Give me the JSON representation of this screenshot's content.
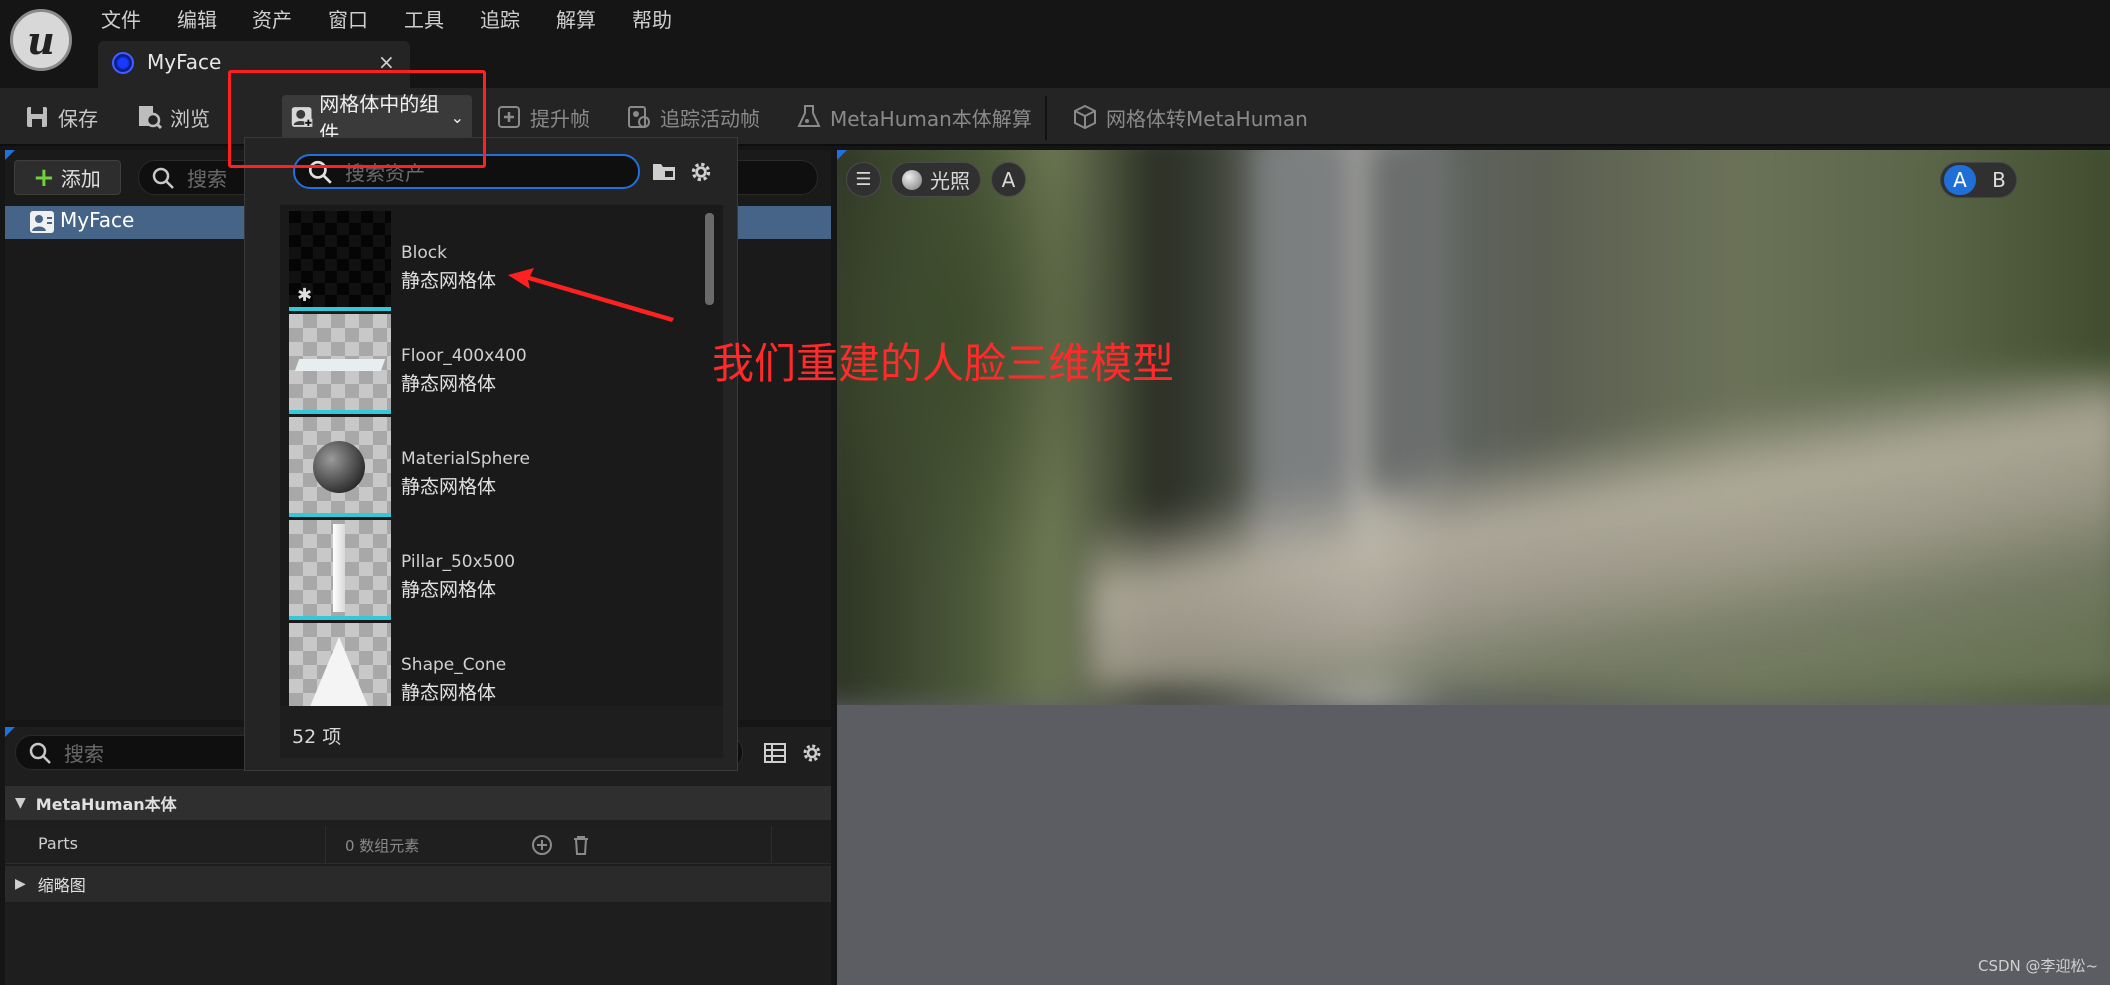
{
  "menu": [
    "文件",
    "编辑",
    "资产",
    "窗口",
    "工具",
    "追踪",
    "解算",
    "帮助"
  ],
  "tab": {
    "label": "MyFace",
    "close": "×"
  },
  "toolbar": {
    "save": "保存",
    "browse": "浏览",
    "component": "网格体中的组件",
    "promote": "提升帧",
    "track": "追踪活动帧",
    "solve": "MetaHuman本体解算",
    "convert": "网格体转MetaHuman"
  },
  "left": {
    "add": "添加",
    "search_placeholder": "搜索",
    "tree_item": "MyFace",
    "detail_search": "搜索",
    "section": "MetaHuman本体",
    "parts_label": "Parts",
    "parts_value": "0 数组元素",
    "thumbnail": "缩略图"
  },
  "dropdown": {
    "search_placeholder": "搜索资产",
    "assets": [
      {
        "name": "Block",
        "type": "静态网格体",
        "thumb": "dark"
      },
      {
        "name": "Floor_400x400",
        "type": "静态网格体",
        "thumb": "floor"
      },
      {
        "name": "MaterialSphere",
        "type": "静态网格体",
        "thumb": "sphere"
      },
      {
        "name": "Pillar_50x500",
        "type": "静态网格体",
        "thumb": "pillar"
      },
      {
        "name": "Shape_Cone",
        "type": "静态网格体",
        "thumb": "cone"
      }
    ],
    "count": "52 项"
  },
  "viewport": {
    "lighting": "光照",
    "a": "A",
    "ab_a": "A",
    "ab_b": "B"
  },
  "annotation": "我们重建的人脸三维模型",
  "watermark": "CSDN @李迎松~",
  "colors": {
    "accent": "#2070e0",
    "annotation": "#ff2a2a",
    "selection": "#466488"
  }
}
